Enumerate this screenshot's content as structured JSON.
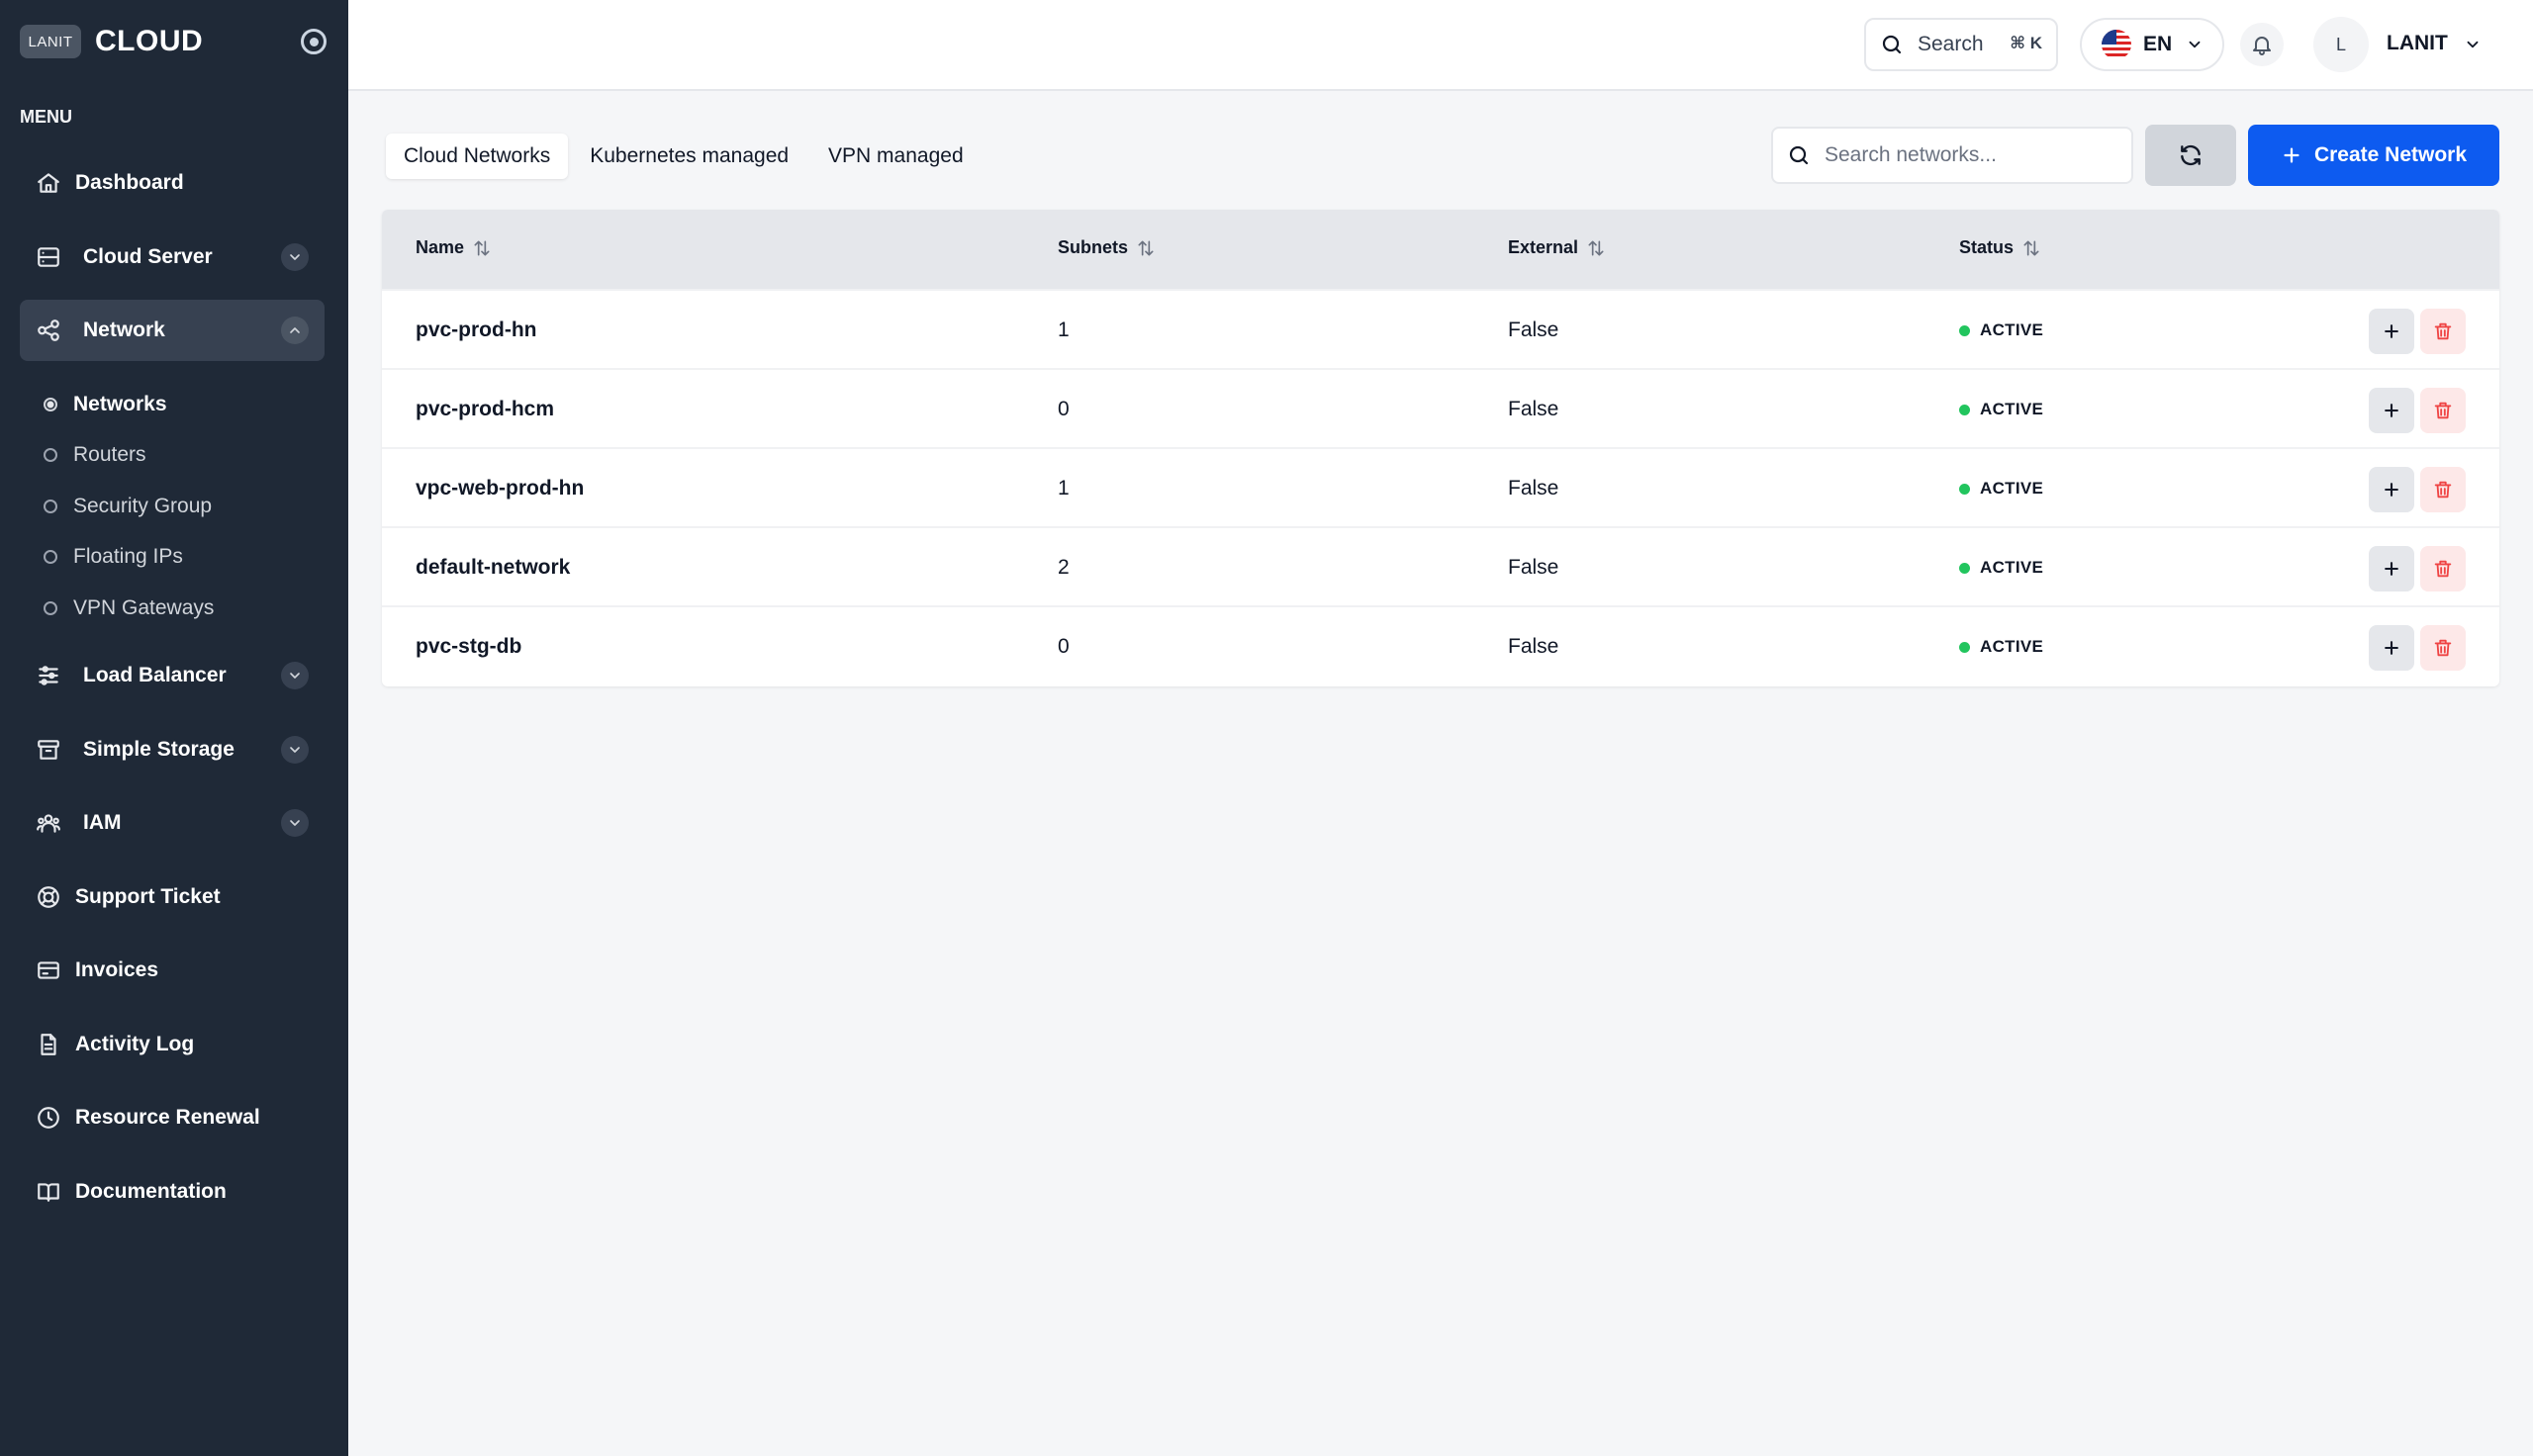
{
  "brand": {
    "logo_text": "LANIT",
    "name": "CLOUD"
  },
  "sidebar": {
    "menu_heading": "MENU",
    "items": [
      {
        "label": "Dashboard",
        "icon": "home-icon"
      },
      {
        "label": "Cloud Server",
        "icon": "server-icon",
        "expandable": true
      },
      {
        "label": "Network",
        "icon": "share-nodes-icon",
        "expandable": true,
        "expanded": true,
        "active": true
      },
      {
        "label": "Load Balancer",
        "icon": "sliders-icon",
        "expandable": true
      },
      {
        "label": "Simple Storage",
        "icon": "archive-icon",
        "expandable": true
      },
      {
        "label": "IAM",
        "icon": "users-icon",
        "expandable": true
      },
      {
        "label": "Support Ticket",
        "icon": "lifebuoy-icon"
      },
      {
        "label": "Invoices",
        "icon": "credit-card-icon"
      },
      {
        "label": "Activity Log",
        "icon": "file-text-icon"
      },
      {
        "label": "Resource Renewal",
        "icon": "clock-icon"
      },
      {
        "label": "Documentation",
        "icon": "book-open-icon"
      }
    ],
    "network_subitems": [
      {
        "label": "Networks",
        "active": true
      },
      {
        "label": "Routers"
      },
      {
        "label": "Security Group"
      },
      {
        "label": "Floating IPs"
      },
      {
        "label": "VPN Gateways"
      }
    ]
  },
  "header": {
    "search_label": "Search",
    "search_shortcut": "⌘ K",
    "language": "EN",
    "avatar_initial": "L",
    "user_name": "LANIT"
  },
  "toolbar": {
    "tabs": [
      {
        "label": "Cloud Networks",
        "active": true
      },
      {
        "label": "Kubernetes managed"
      },
      {
        "label": "VPN managed"
      }
    ],
    "search_placeholder": "Search networks...",
    "create_label": "Create Network"
  },
  "table": {
    "columns": [
      "Name",
      "Subnets",
      "External",
      "Status"
    ],
    "rows": [
      {
        "name": "pvc-prod-hn",
        "subnets": "1",
        "external": "False",
        "status": "ACTIVE"
      },
      {
        "name": "pvc-prod-hcm",
        "subnets": "0",
        "external": "False",
        "status": "ACTIVE"
      },
      {
        "name": "vpc-web-prod-hn",
        "subnets": "1",
        "external": "False",
        "status": "ACTIVE"
      },
      {
        "name": "default-network",
        "subnets": "2",
        "external": "False",
        "status": "ACTIVE"
      },
      {
        "name": "pvc-stg-db",
        "subnets": "0",
        "external": "False",
        "status": "ACTIVE"
      }
    ]
  },
  "colors": {
    "sidebar_bg": "#1f2937",
    "primary": "#0d5bf0",
    "status_active": "#22c55e",
    "danger": "#ef4444"
  }
}
